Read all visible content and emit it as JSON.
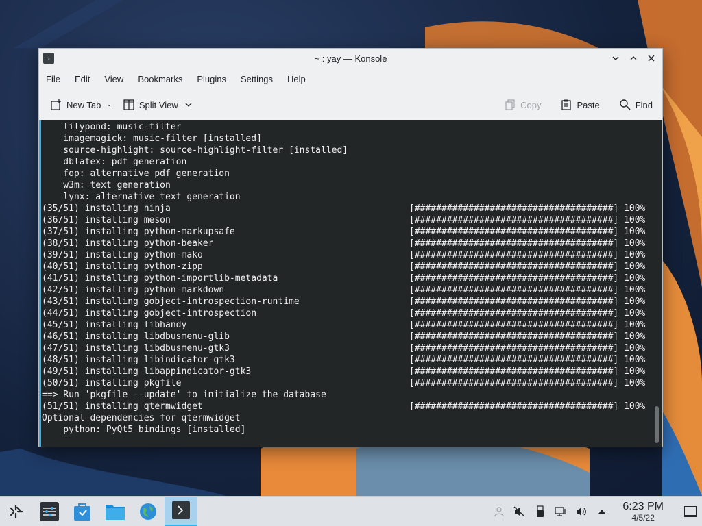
{
  "window": {
    "title": "~ : yay — Konsole"
  },
  "menu": [
    "File",
    "Edit",
    "View",
    "Bookmarks",
    "Plugins",
    "Settings",
    "Help"
  ],
  "toolbar": {
    "new_tab": "New Tab",
    "split_view": "Split View",
    "copy": "Copy",
    "paste": "Paste",
    "find": "Find"
  },
  "terminal": {
    "lines": [
      {
        "text": "    lilypond: music-filter",
        "progress": ""
      },
      {
        "text": "    imagemagick: music-filter [installed]",
        "progress": ""
      },
      {
        "text": "    source-highlight: source-highlight-filter [installed]",
        "progress": ""
      },
      {
        "text": "    dblatex: pdf generation",
        "progress": ""
      },
      {
        "text": "    fop: alternative pdf generation",
        "progress": ""
      },
      {
        "text": "    w3m: text generation",
        "progress": ""
      },
      {
        "text": "    lynx: alternative text generation",
        "progress": ""
      },
      {
        "text": "(35/51) installing ninja",
        "progress": "[#####################################] 100%"
      },
      {
        "text": "(36/51) installing meson",
        "progress": "[#####################################] 100%"
      },
      {
        "text": "(37/51) installing python-markupsafe",
        "progress": "[#####################################] 100%"
      },
      {
        "text": "(38/51) installing python-beaker",
        "progress": "[#####################################] 100%"
      },
      {
        "text": "(39/51) installing python-mako",
        "progress": "[#####################################] 100%"
      },
      {
        "text": "(40/51) installing python-zipp",
        "progress": "[#####################################] 100%"
      },
      {
        "text": "(41/51) installing python-importlib-metadata",
        "progress": "[#####################################] 100%"
      },
      {
        "text": "(42/51) installing python-markdown",
        "progress": "[#####################################] 100%"
      },
      {
        "text": "(43/51) installing gobject-introspection-runtime",
        "progress": "[#####################################] 100%"
      },
      {
        "text": "(44/51) installing gobject-introspection",
        "progress": "[#####################################] 100%"
      },
      {
        "text": "(45/51) installing libhandy",
        "progress": "[#####################################] 100%"
      },
      {
        "text": "(46/51) installing libdbusmenu-glib",
        "progress": "[#####################################] 100%"
      },
      {
        "text": "(47/51) installing libdbusmenu-gtk3",
        "progress": "[#####################################] 100%"
      },
      {
        "text": "(48/51) installing libindicator-gtk3",
        "progress": "[#####################################] 100%"
      },
      {
        "text": "(49/51) installing libappindicator-gtk3",
        "progress": "[#####################################] 100%"
      },
      {
        "text": "(50/51) installing pkgfile",
        "progress": "[#####################################] 100%"
      },
      {
        "text": "==> Run 'pkgfile --update' to initialize the database",
        "progress": ""
      },
      {
        "text": "(51/51) installing qtermwidget",
        "progress": "[#####################################] 100%"
      },
      {
        "text": "Optional dependencies for qtermwidget",
        "progress": ""
      },
      {
        "text": "    python: PyQt5 bindings [installed]",
        "progress": ""
      }
    ]
  },
  "taskbar": {
    "time": "6:23 PM",
    "date": "4/5/22"
  },
  "colors": {
    "accent": "#3daee9",
    "terminal_bg": "#232627",
    "terminal_fg": "#eff0f1"
  }
}
